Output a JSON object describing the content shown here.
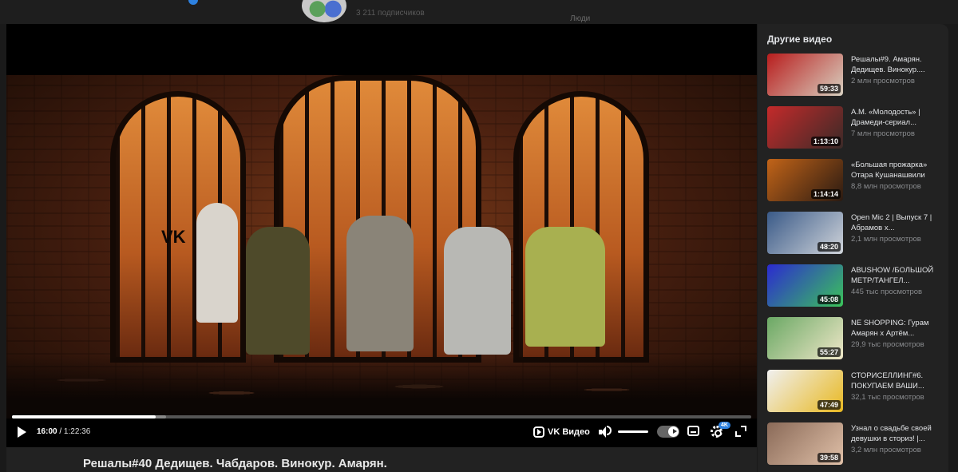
{
  "top": {
    "subscribers": "3 211 подписчиков",
    "people_label": "Люди"
  },
  "player": {
    "current_time": "16:00",
    "separator": " / ",
    "total_time": "1:22:36",
    "progress": 0.194,
    "buffered": 0.208,
    "brand": "VK Видео",
    "quality_badge": "4K",
    "scene_logo": "VK"
  },
  "video": {
    "title": "Решалы#40 Дедищев. Чабдаров. Винокур. Амарян."
  },
  "sidebar": {
    "title": "Другие видео",
    "items": [
      {
        "title": "Решалы#9. Амарян. Дедищев. Винокур....",
        "views": "2 млн просмотров",
        "duration": "59:33",
        "thumb_colors": [
          "#b81d1d",
          "#d8d0c0"
        ]
      },
      {
        "title": "А.М. «Молодость» | Драмеди-сериал...",
        "views": "7 млн просмотров",
        "duration": "1:13:10",
        "thumb_colors": [
          "#c42a2a",
          "#3a2a28"
        ]
      },
      {
        "title": "«Большая прожарка» Отара Кушанашвили",
        "views": "8,8 млн просмотров",
        "duration": "1:14:14",
        "thumb_colors": [
          "#c26418",
          "#2a1a12"
        ]
      },
      {
        "title": "Open Mic 2 | Выпуск 7 | Абрамов х...",
        "views": "2,1 млн просмотров",
        "duration": "48:20",
        "thumb_colors": [
          "#3a5a88",
          "#d0d4da"
        ]
      },
      {
        "title": "ABUSHOW /БОЛЬШОЙ МЕТР/ТАНГЕЛ...",
        "views": "445 тыс просмотров",
        "duration": "45:08",
        "thumb_colors": [
          "#2b2ad0",
          "#3bc45a"
        ]
      },
      {
        "title": "NE SHOPPING: Гурам Амарян х Артём...",
        "views": "29,9 тыс просмотров",
        "duration": "55:27",
        "thumb_colors": [
          "#6aa864",
          "#efe7c8"
        ]
      },
      {
        "title": "СТОРИСЕЛЛИНГ#6. ПОКУПАЕМ ВАШИ...",
        "views": "32,1 тыс просмотров",
        "duration": "47:49",
        "thumb_colors": [
          "#f0f0f0",
          "#e8b820"
        ]
      },
      {
        "title": "Узнал о свадьбе своей девушки в сториз! |...",
        "views": "3,2 млн просмотров",
        "duration": "39:58",
        "thumb_colors": [
          "#8a6a58",
          "#e0c0a8"
        ]
      }
    ]
  },
  "colors": {
    "accent": "#2d81e0",
    "background": "#1a1a1a",
    "sidebar_bg": "#222222"
  }
}
